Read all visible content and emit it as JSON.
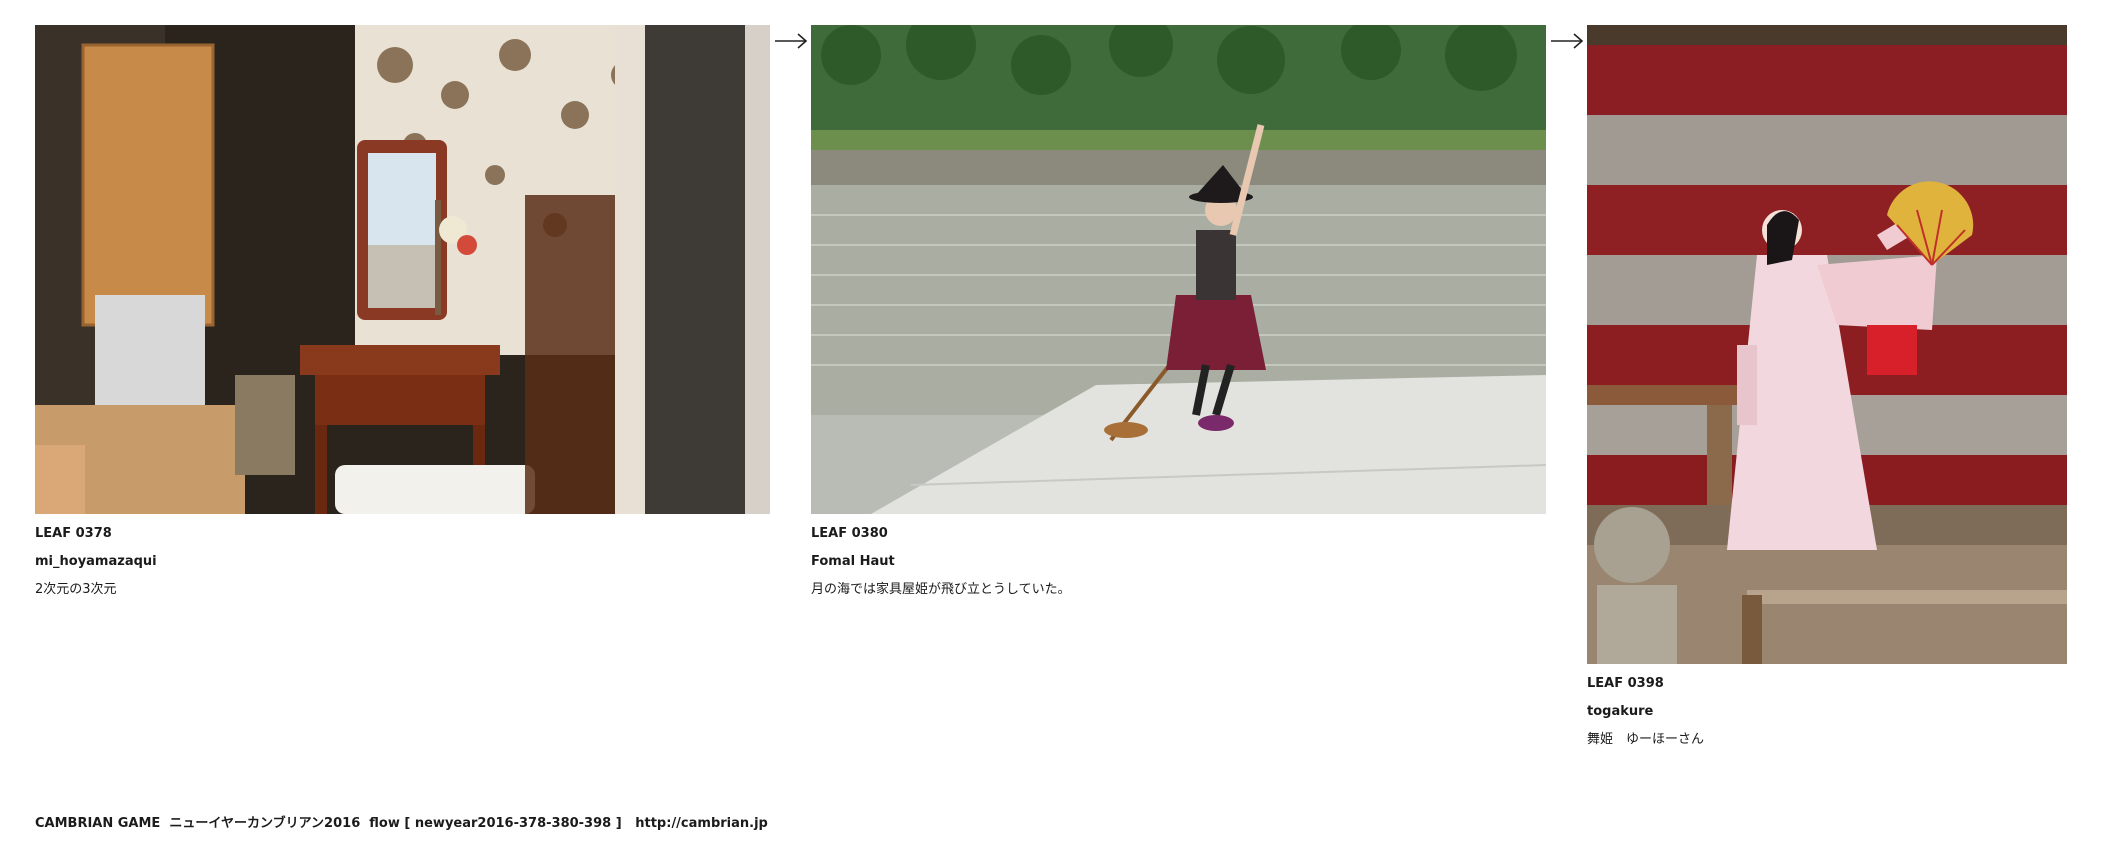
{
  "leaves": [
    {
      "code": "LEAF 0378",
      "author": "mi_hoyamazaqui",
      "comment": "2次元の3次元",
      "photo_subject": "furniture-shop-window-photo"
    },
    {
      "code": "LEAF 0380",
      "author": "Fomal Haut",
      "comment": "月の海では家具屋姫が飛び立とうしていた。",
      "photo_subject": "witch-on-pier-photo"
    },
    {
      "code": "LEAF 0398",
      "author": "togakure",
      "comment": "舞姫　ゆーほーさん",
      "photo_subject": "dancer-on-stage-photo"
    }
  ],
  "arrows": [
    "right-arrow-icon",
    "right-arrow-icon"
  ],
  "footer": {
    "text": "CAMBRIAN GAME  ニューイヤーカンブリアン2016  flow [ newyear2016-378-380-398 ]   ",
    "link": "http://cambrian.jp"
  }
}
